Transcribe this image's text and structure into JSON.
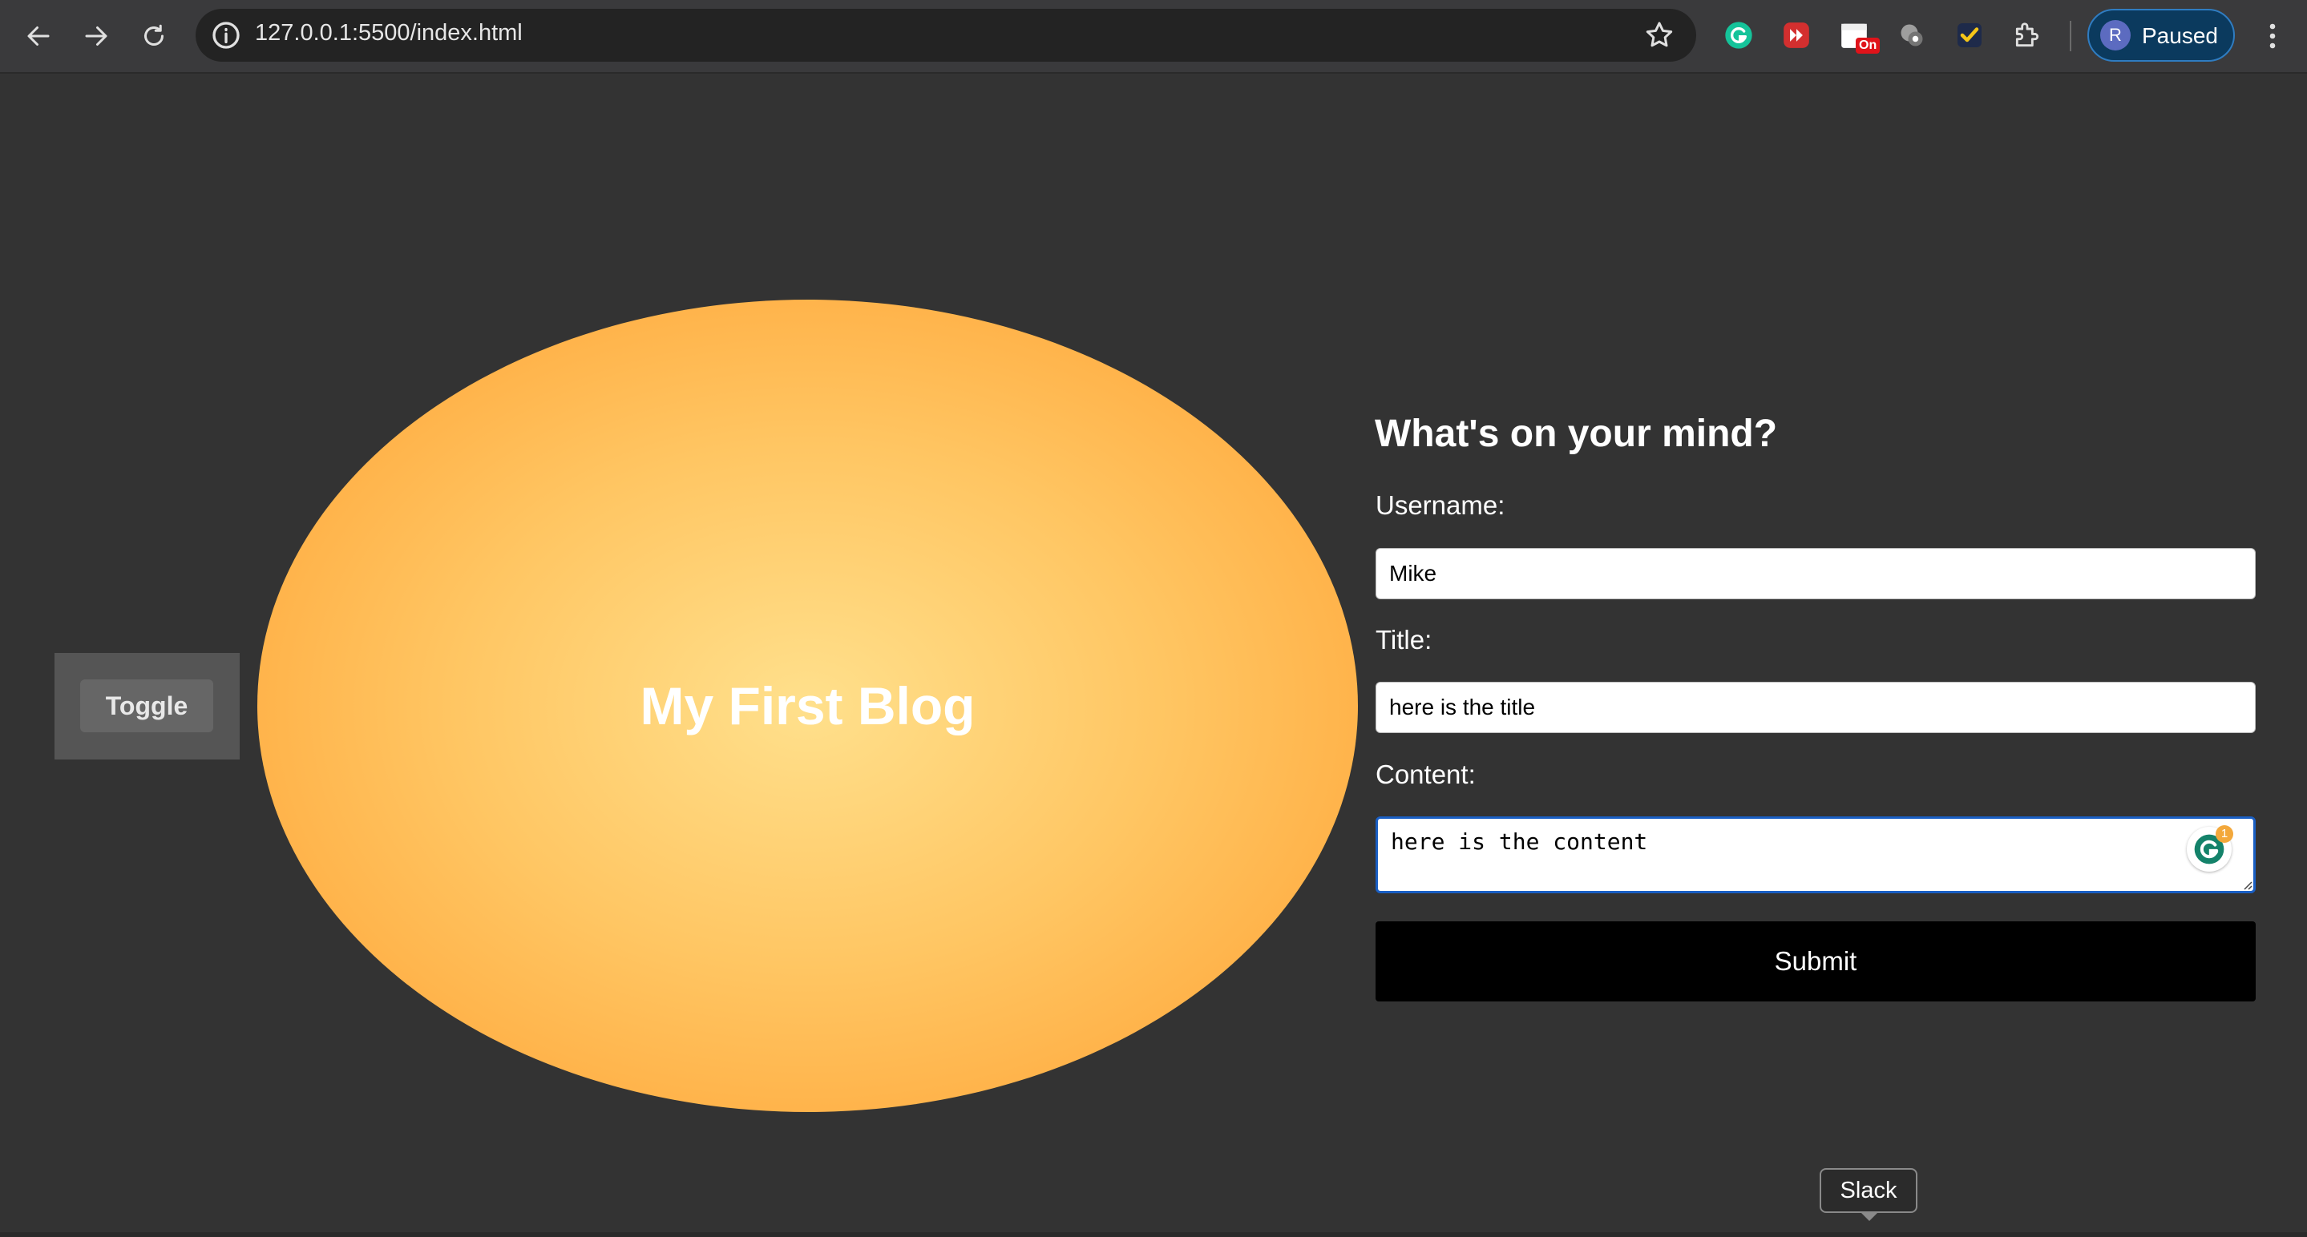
{
  "browser": {
    "url": "127.0.0.1:5500/index.html",
    "profile_initial": "R",
    "profile_status": "Paused",
    "extension_badge": "On",
    "icons": [
      "back-icon",
      "forward-icon",
      "reload-icon",
      "site-info-icon",
      "bookmark-star-icon",
      "grammarly-extension-icon",
      "video-speed-extension-icon",
      "calendar-extension-icon",
      "privacy-extension-icon",
      "checkmark-extension-icon",
      "extensions-puzzle-icon",
      "more-menu-icon"
    ]
  },
  "page": {
    "toggle_label": "Toggle",
    "hero_title": "My First Blog",
    "form": {
      "heading": "What's on your mind?",
      "username_label": "Username:",
      "username_value": "Mike",
      "title_label": "Title:",
      "title_value": "here is the title",
      "content_label": "Content:",
      "content_value": "here is the content",
      "grammarly_count": "1",
      "submit_label": "Submit"
    }
  },
  "tooltip": {
    "text": "Slack"
  },
  "colors": {
    "background": "#333333",
    "ellipse_center": "#ffe08c",
    "ellipse_edge": "#ff9f30",
    "submit_bg": "#000000",
    "focus_border": "#1a5fc4"
  }
}
